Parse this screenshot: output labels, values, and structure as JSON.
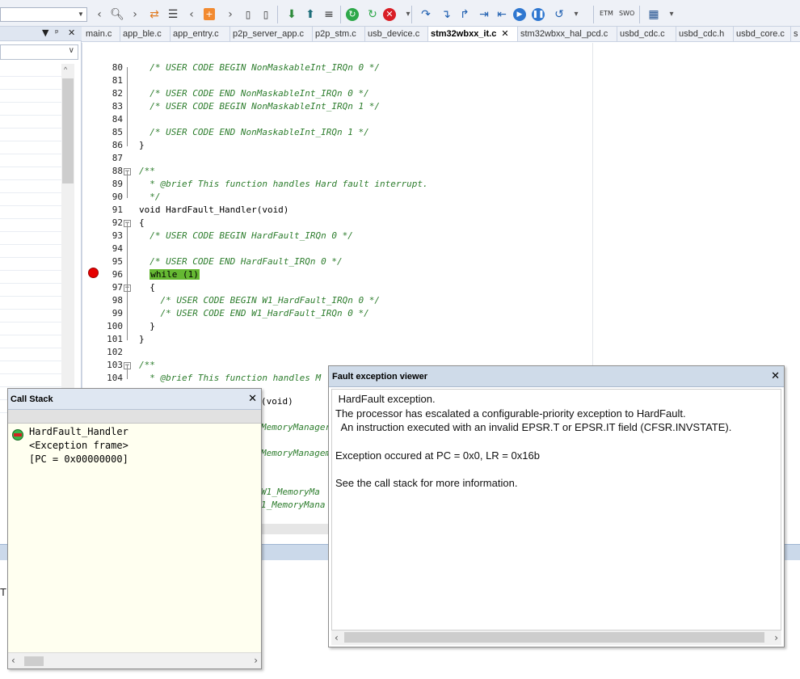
{
  "toolbar": {
    "icons": [
      "combo-dropdown",
      "back-arrow",
      "search",
      "forward-arrow",
      "swap-arrows",
      "indent-list",
      "back-nav",
      "bookmark",
      "forward-nav",
      "page-prev",
      "page-next",
      "download-green",
      "upload-green",
      "menu-list",
      "reset-green",
      "refresh-green",
      "stop-red",
      "step-over",
      "step-into",
      "step-out",
      "run-to-cursor",
      "step-line",
      "run",
      "pause",
      "step-back"
    ],
    "etm_label": "ETM",
    "swo_label": "SWO"
  },
  "left_pane": {
    "gear": "⚙",
    "dot": "●",
    "check": "✔"
  },
  "tabs": [
    {
      "label": "main.c"
    },
    {
      "label": "app_ble.c"
    },
    {
      "label": "app_entry.c"
    },
    {
      "label": "p2p_server_app.c"
    },
    {
      "label": "p2p_stm.c"
    },
    {
      "label": "usb_device.c"
    },
    {
      "label": "stm32wbxx_it.c",
      "active": true
    },
    {
      "label": "stm32wbxx_hal_pcd.c"
    },
    {
      "label": "usbd_cdc.c"
    },
    {
      "label": "usbd_cdc.h"
    },
    {
      "label": "usbd_core.c"
    },
    {
      "label": "s"
    }
  ],
  "editor": {
    "lines": [
      {
        "n": "80",
        "text": "  /* USER CODE BEGIN NonMaskableInt_IRQn 0 */",
        "type": "comment"
      },
      {
        "n": "81",
        "text": "",
        "type": "code"
      },
      {
        "n": "82",
        "text": "  /* USER CODE END NonMaskableInt_IRQn 0 */",
        "type": "comment"
      },
      {
        "n": "83",
        "text": "  /* USER CODE BEGIN NonMaskableInt_IRQn 1 */",
        "type": "comment"
      },
      {
        "n": "84",
        "text": "",
        "type": "code"
      },
      {
        "n": "85",
        "text": "  /* USER CODE END NonMaskableInt_IRQn 1 */",
        "type": "comment"
      },
      {
        "n": "86",
        "text": "}",
        "type": "code"
      },
      {
        "n": "87",
        "text": "",
        "type": "code"
      },
      {
        "n": "88",
        "text": "/**",
        "type": "comment"
      },
      {
        "n": "89",
        "text": "  * @brief This function handles Hard fault interrupt.",
        "type": "comment"
      },
      {
        "n": "90",
        "text": "  */",
        "type": "comment"
      },
      {
        "n": "91",
        "text": "void HardFault_Handler(void)",
        "type": "code"
      },
      {
        "n": "92",
        "text": "{",
        "type": "code"
      },
      {
        "n": "93",
        "text": "  /* USER CODE BEGIN HardFault_IRQn 0 */",
        "type": "comment"
      },
      {
        "n": "94",
        "text": "",
        "type": "code"
      },
      {
        "n": "95",
        "text": "  /* USER CODE END HardFault_IRQn 0 */",
        "type": "comment"
      },
      {
        "n": "96",
        "text": "while (1)",
        "type": "highlight"
      },
      {
        "n": "97",
        "text": "  {",
        "type": "code"
      },
      {
        "n": "98",
        "text": "    /* USER CODE BEGIN W1_HardFault_IRQn 0 */",
        "type": "comment"
      },
      {
        "n": "99",
        "text": "    /* USER CODE END W1_HardFault_IRQn 0 */",
        "type": "comment"
      },
      {
        "n": "100",
        "text": "  }",
        "type": "code"
      },
      {
        "n": "101",
        "text": "}",
        "type": "code"
      },
      {
        "n": "102",
        "text": "",
        "type": "code"
      },
      {
        "n": "103",
        "text": "/**",
        "type": "comment"
      },
      {
        "n": "104",
        "text": "  * @brief This function handles M",
        "type": "comment"
      }
    ],
    "partial_lines": [
      {
        "text": "(void)",
        "type": "code"
      },
      {
        "text": "MemoryManager",
        "type": "comment"
      },
      {
        "text": "MemoryManagemen",
        "type": "comment"
      },
      {
        "text": "W1_MemoryMa",
        "type": "comment"
      },
      {
        "text": "1_MemoryMana",
        "type": "comment"
      }
    ]
  },
  "callstack": {
    "title": "Call Stack",
    "close": "✕",
    "lines": [
      "HardFault_Handler",
      "<Exception frame>",
      "[PC = 0x00000000]"
    ]
  },
  "faultview": {
    "title": "Fault exception viewer",
    "close": "✕",
    "lines": [
      " HardFault exception.",
      "The processor has escalated a configurable-priority exception to HardFault.",
      "  An instruction executed with an invalid EPSR.T or EPSR.IT field (CFSR.INVSTATE).",
      "",
      "Exception occured at PC = 0x0, LR = 0x16b",
      "",
      "See the call stack for more information."
    ]
  },
  "bottom": {
    "t_char": "T"
  }
}
